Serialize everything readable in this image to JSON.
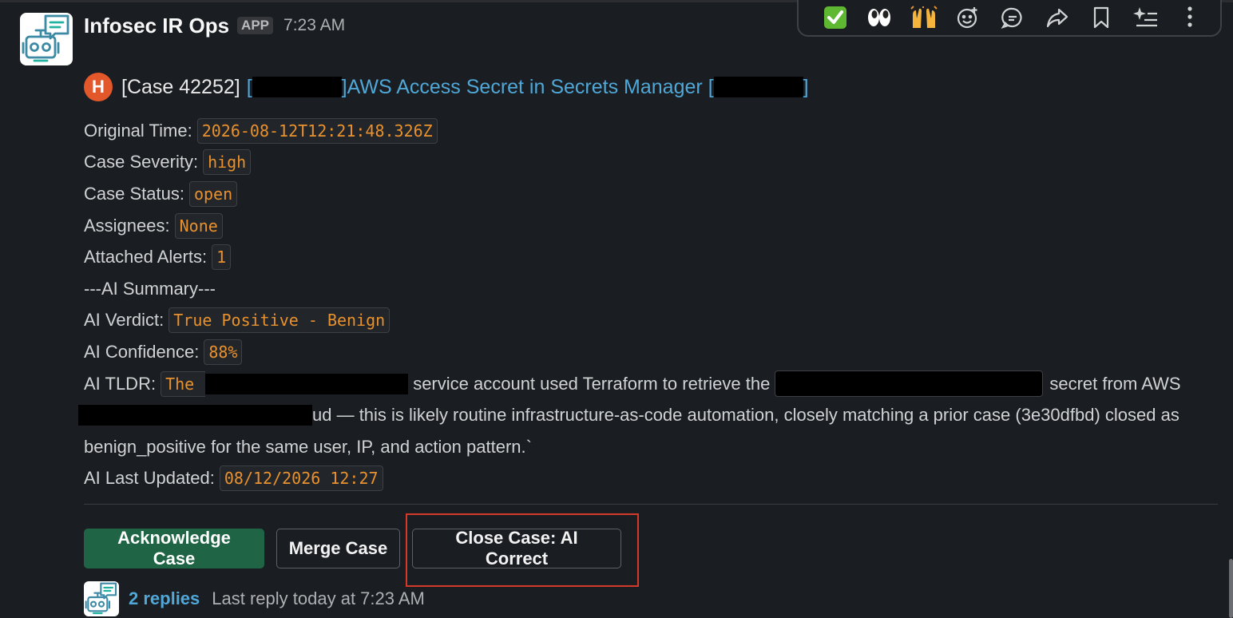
{
  "toolbar": {
    "actions": [
      {
        "icon": "white-check-mark-emoji",
        "glyph": "✅"
      },
      {
        "icon": "eyes-emoji",
        "glyph": "👀"
      },
      {
        "icon": "raised-hands-emoji",
        "glyph": "🙌"
      },
      {
        "icon": "add-reaction-icon"
      },
      {
        "icon": "reply-in-thread-icon"
      },
      {
        "icon": "share-message-icon"
      },
      {
        "icon": "bookmark-icon"
      },
      {
        "icon": "ai-sparkle-icon"
      },
      {
        "icon": "more-actions-icon"
      }
    ]
  },
  "message": {
    "sender": "Infosec IR Ops",
    "badge": "APP",
    "time": "7:23 AM",
    "severity_letter": "H",
    "severity_color": "#e2582b",
    "case_number": "[Case 42252]",
    "link_open_bracket": "[",
    "title_close_bracket": "]",
    "title_text": "AWS Access Secret in Secrets Manager",
    "title_suffix_open": "[",
    "title_suffix_close": "]",
    "fields": [
      {
        "label": "Original Time:",
        "value": "2026-08-12T12:21:48.326Z"
      },
      {
        "label": "Case Severity:",
        "value": "high"
      },
      {
        "label": "Case Status:",
        "value": "open"
      },
      {
        "label": "Assignees:",
        "value": "None"
      },
      {
        "label": "Attached Alerts:",
        "value": "1"
      }
    ],
    "ai_summary_header": "---AI Summary---",
    "ai_fields": [
      {
        "label": "AI Verdict:",
        "value": "True Positive - Benign"
      },
      {
        "label": "AI Confidence:",
        "value": "88%"
      }
    ],
    "tldr": {
      "label": "AI TLDR:",
      "code_start": "The",
      "text_1": "service account used Terraform to retrieve the",
      "text_2": "secret from AWS",
      "text_3": "ud — this is likely routine infrastructure-as-code automation, closely matching a prior case (3e30dfbd) closed as",
      "text_4": "benign_positive for the same user, IP, and action pattern.`"
    },
    "last_updated": {
      "label": "AI Last Updated:",
      "value": "08/12/2026 12:27"
    }
  },
  "actions": {
    "acknowledge": "Acknowledge Case",
    "merge": "Merge Case",
    "close_correct": "Close Case: AI Correct"
  },
  "thread": {
    "replies": "2 replies",
    "last_reply": "Last reply today at 7:23 AM"
  },
  "colors": {
    "background": "#1a1d21",
    "link": "#4fa8d8",
    "code_text": "#e8912d",
    "primary_button": "#1f6545",
    "highlight": "#d4392a"
  }
}
